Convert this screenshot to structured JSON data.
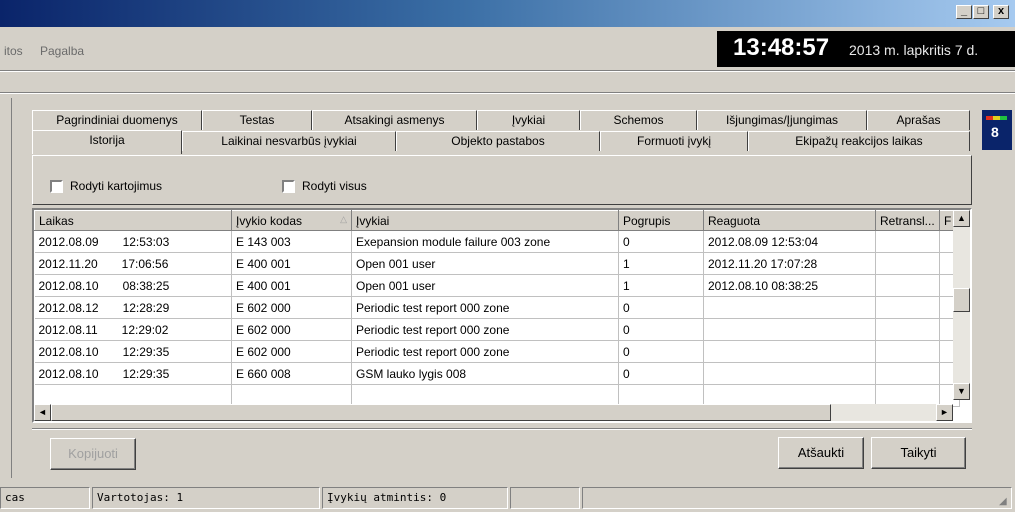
{
  "window": {
    "minimize": "_",
    "maximize": "□",
    "close": "x"
  },
  "menu": {
    "items": [
      "itos",
      "Pagalba"
    ]
  },
  "clock": {
    "time": "13:48:57",
    "date": "2013 m. lapkritis 7 d."
  },
  "tabs": {
    "row1": [
      "Pagrindiniai duomenys",
      "Testas",
      "Atsakingi asmenys",
      "Įvykiai",
      "Schemos",
      "Išjungimas/Įjungimas",
      "Aprašas"
    ],
    "row2": [
      "Istorija",
      "Laikinai nesvarbūs įvykiai",
      "Objekto pastabos",
      "Formuoti įvykį",
      "Ekipažų reakcijos laikas"
    ],
    "selected": "Istorija"
  },
  "options": {
    "show_repeats": "Rodyti kartojimus",
    "show_all": "Rodyti visus"
  },
  "table": {
    "columns": [
      "Laikas",
      "Įvykio kodas",
      "Įvykiai",
      "Pogrupis",
      "Reaguota",
      "Retransl...",
      "F"
    ],
    "rows": [
      {
        "date": "2012.08.09",
        "time": "12:53:03",
        "code": "E 143 003",
        "event": "Exepansion module failure 003 zone",
        "sub": "0",
        "reacted": "2012.08.09 12:53:04"
      },
      {
        "date": "2012.11.20",
        "time": "17:06:56",
        "code": "E 400 001",
        "event": "Open 001 user",
        "sub": "1",
        "reacted": "2012.11.20 17:07:28"
      },
      {
        "date": "2012.08.10",
        "time": "08:38:25",
        "code": "E 400 001",
        "event": "Open 001 user",
        "sub": "1",
        "reacted": "2012.08.10 08:38:25"
      },
      {
        "date": "2012.08.12",
        "time": "12:28:29",
        "code": "E 602 000",
        "event": "Periodic test report 000 zone",
        "sub": "0",
        "reacted": ""
      },
      {
        "date": "2012.08.11",
        "time": "12:29:02",
        "code": "E 602 000",
        "event": "Periodic test report 000 zone",
        "sub": "0",
        "reacted": ""
      },
      {
        "date": "2012.08.10",
        "time": "12:29:35",
        "code": "E 602 000",
        "event": "Periodic test report 000 zone",
        "sub": "0",
        "reacted": ""
      },
      {
        "date": "2012.08.10",
        "time": "12:29:35",
        "code": "E 660 008",
        "event": "GSM lauko lygis 008",
        "sub": "0",
        "reacted": ""
      }
    ]
  },
  "buttons": {
    "copy": "Kopijuoti",
    "cancel": "Atšaukti",
    "apply": "Taikyti"
  },
  "side": {
    "counter": "8"
  },
  "status": {
    "pane1": "cas",
    "user": "Vartotojas: 1",
    "memory": "Įvykių atmintis: 0"
  },
  "colors": {
    "title_gradient_start": "#0a246a",
    "title_gradient_end": "#a6caf0",
    "clock_bg": "#000000",
    "window_bg": "#d4d0c8"
  }
}
